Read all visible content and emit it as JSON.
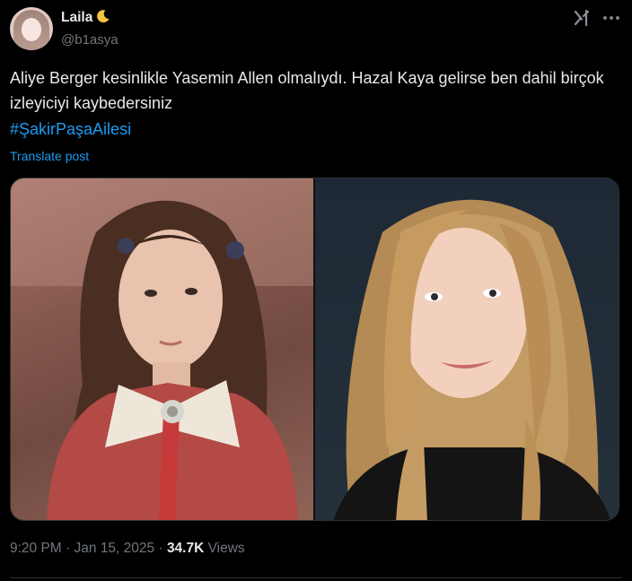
{
  "author": {
    "display_name": "Laila",
    "handle": "@b1asya",
    "name_emoji": "crescent-moon-icon"
  },
  "tweet": {
    "text": "Aliye Berger kesinlikle Yasemin Allen olmalıydı. Hazal Kaya gelirse ben dahil birçok izleyiciyi kaybedersiniz",
    "hashtag": "#ŞakirPaşaAilesi",
    "translate_label": "Translate post"
  },
  "media": {
    "images": [
      {
        "name": "photo-young-girl"
      },
      {
        "name": "photo-blonde-woman"
      }
    ]
  },
  "meta": {
    "time": "9:20 PM",
    "separator1": " · ",
    "date": "Jan 15, 2025",
    "separator2": " · ",
    "views_count": "34.7K",
    "views_label": " Views"
  },
  "icons": {
    "grok": "grok-icon",
    "more": "more-icon"
  },
  "colors": {
    "background": "#000000",
    "text": "#e7e9ea",
    "muted": "#71767b",
    "link": "#1d9bf0",
    "border": "#2f3336"
  }
}
